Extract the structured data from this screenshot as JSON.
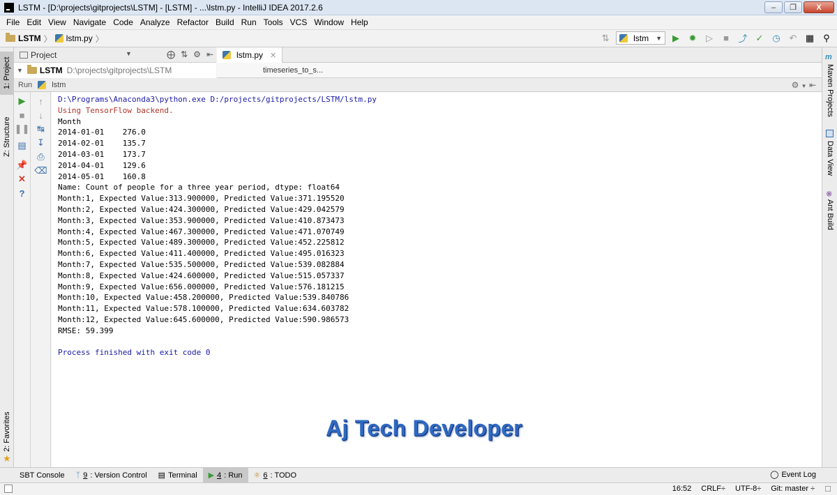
{
  "window": {
    "title": "LSTM - [D:\\projects\\gitprojects\\LSTM] - [LSTM] - ...\\lstm.py - IntelliJ IDEA 2017.2.6",
    "minimize": "–",
    "maximize": "❐",
    "close": "X"
  },
  "menu": [
    "File",
    "Edit",
    "View",
    "Navigate",
    "Code",
    "Analyze",
    "Refactor",
    "Build",
    "Run",
    "Tools",
    "VCS",
    "Window",
    "Help"
  ],
  "breadcrumb": {
    "project": "LSTM",
    "file": "lstm.py"
  },
  "toolbar": {
    "run_config": "lstm"
  },
  "project_panel": {
    "header": "Project",
    "root_name": "LSTM",
    "root_path": "D:\\projects\\gitprojects\\LSTM"
  },
  "editor": {
    "tab_label": "lstm.py",
    "breadcrumb": "timeseries_to_s..."
  },
  "run_panel": {
    "label": "Run",
    "config": "lstm"
  },
  "left_tabs": {
    "project": "1: Project",
    "structure": "Z: Structure",
    "favorites": "2: Favorites"
  },
  "right_tabs": {
    "maven": "Maven Projects",
    "data_view": "Data View",
    "ant": "Ant Build"
  },
  "console": {
    "lines": [
      {
        "text": "D:\\Programs\\Anaconda3\\python.exe D:/projects/gitprojects/LSTM/lstm.py",
        "kind": "cmd"
      },
      {
        "text": "Using TensorFlow backend.",
        "kind": "err"
      },
      {
        "text": "Month",
        "kind": "out"
      },
      {
        "text": "2014-01-01    276.0",
        "kind": "out"
      },
      {
        "text": "2014-02-01    135.7",
        "kind": "out"
      },
      {
        "text": "2014-03-01    173.7",
        "kind": "out"
      },
      {
        "text": "2014-04-01    129.6",
        "kind": "out"
      },
      {
        "text": "2014-05-01    160.8",
        "kind": "out"
      },
      {
        "text": "Name: Count of people for a three year period, dtype: float64",
        "kind": "out"
      },
      {
        "text": "Month:1, Expected Value:313.900000, Predicted Value:371.195520",
        "kind": "out"
      },
      {
        "text": "Month:2, Expected Value:424.300000, Predicted Value:429.042579",
        "kind": "out"
      },
      {
        "text": "Month:3, Expected Value:353.900000, Predicted Value:410.873473",
        "kind": "out"
      },
      {
        "text": "Month:4, Expected Value:467.300000, Predicted Value:471.070749",
        "kind": "out"
      },
      {
        "text": "Month:5, Expected Value:489.300000, Predicted Value:452.225812",
        "kind": "out"
      },
      {
        "text": "Month:6, Expected Value:411.400000, Predicted Value:495.016323",
        "kind": "out"
      },
      {
        "text": "Month:7, Expected Value:535.500000, Predicted Value:539.082884",
        "kind": "out"
      },
      {
        "text": "Month:8, Expected Value:424.600000, Predicted Value:515.057337",
        "kind": "out"
      },
      {
        "text": "Month:9, Expected Value:656.000000, Predicted Value:576.181215",
        "kind": "out"
      },
      {
        "text": "Month:10, Expected Value:458.200000, Predicted Value:539.840786",
        "kind": "out"
      },
      {
        "text": "Month:11, Expected Value:578.100000, Predicted Value:634.603782",
        "kind": "out"
      },
      {
        "text": "Month:12, Expected Value:645.600000, Predicted Value:590.986573",
        "kind": "out"
      },
      {
        "text": "RMSE: 59.399",
        "kind": "out"
      },
      {
        "text": "",
        "kind": "out"
      },
      {
        "text": "Process finished with exit code 0",
        "kind": "exit"
      }
    ]
  },
  "watermark": "Aj Tech Developer",
  "bottom_tabs": {
    "sbt": "SBT Console",
    "vc_num": "9",
    "vc": ": Version Control",
    "terminal": "Terminal",
    "run_num": "4",
    "run": ": Run",
    "todo_num": "6",
    "todo": ": TODO",
    "event_log": "Event Log"
  },
  "status": {
    "position": "16:52",
    "line_sep": "CRLF÷",
    "encoding": "UTF-8÷",
    "git": "Git: master ÷"
  }
}
